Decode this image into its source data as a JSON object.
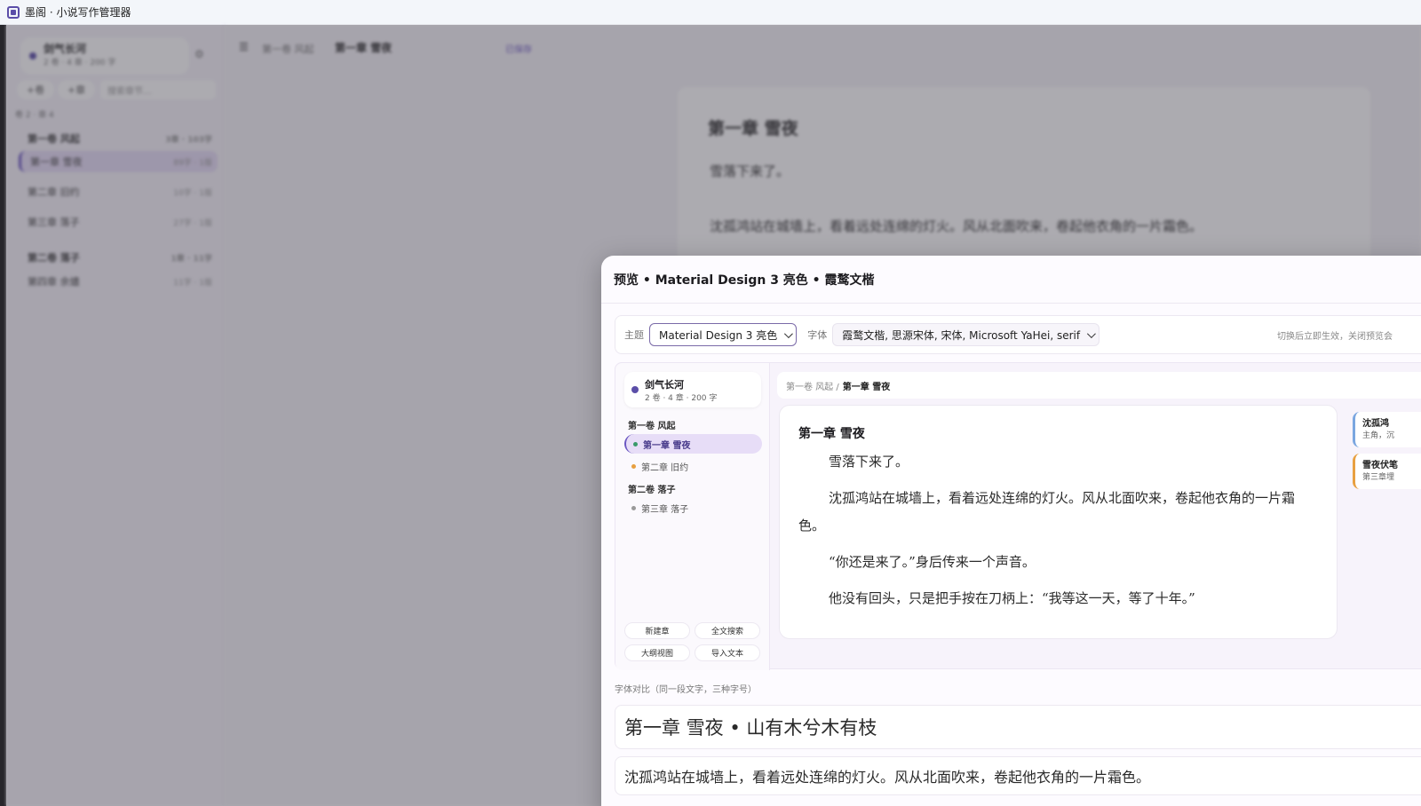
{
  "window": {
    "title": "墨阁 · 小说写作管理器"
  },
  "background": {
    "book": {
      "name": "剑气长河",
      "meta": "2 卷 · 4 章 · 200 字"
    },
    "toolbar": {
      "add_volume": "+卷",
      "add_chapter": "+章",
      "search_placeholder": "搜索章节..."
    },
    "stats": "卷 2 · 章 4",
    "tree": [
      {
        "label": "第一卷 风起",
        "meta": "3章 · 103字"
      },
      {
        "label": "第一章 雪夜",
        "meta": "89字 · 1版"
      },
      {
        "label": "第二章 旧约",
        "meta": "10字 · 1版"
      },
      {
        "label": "第三章 落子",
        "meta": "27字 · 1版"
      },
      {
        "label": "第二卷 落子",
        "meta": "1章 · 11字"
      },
      {
        "label": "第四章 余燼",
        "meta": "11字 · 1版"
      }
    ],
    "breadcrumb": {
      "volume": "第一卷 风起",
      "chapter": "第一章 雪夜"
    },
    "save_status": "已保存",
    "doc": {
      "title": "第一章 雪夜",
      "paragraphs": [
        "雪落下来了。",
        "沈孤鸿站在城墙上，看着远处连绵的灯火。风从北面吹来，卷起他衣角的一片霜色。"
      ]
    }
  },
  "dialog": {
    "title": "预览 • Material Design 3 亮色 • 霞鹜文楷",
    "controls": {
      "theme_label": "主题",
      "theme_value": "Material Design 3 亮色",
      "font_label": "字体",
      "font_value": "霞鹜文楷, 思源宋体, 宋体, Microsoft YaHei, serif",
      "hint": "切换后立即生效，关闭预览会"
    },
    "preview": {
      "book": {
        "name": "剑气长河",
        "meta": "2 卷 · 4 章 · 200 字"
      },
      "volumes": [
        {
          "label": "第一卷 风起",
          "chapters": [
            {
              "label": "第一章 雪夜",
              "dot": "#3a9a6a"
            },
            {
              "label": "第二章 旧约",
              "dot": "#e8a040"
            }
          ]
        },
        {
          "label": "第二卷 落子",
          "chapters": [
            {
              "label": "第三章 落子",
              "dot": "#9a9a9a"
            }
          ]
        }
      ],
      "buttons": {
        "new_chapter": "新建章",
        "fulltext_search": "全文搜索",
        "outline_view": "大纲视图",
        "import_text": "导入文本"
      },
      "breadcrumb": {
        "volume": "第一卷 风起 /",
        "chapter": "第一章 雪夜"
      },
      "doc": {
        "title": "第一章 雪夜",
        "paragraphs": [
          "雪落下来了。",
          "沈孤鸿站在城墙上，看着远处连绵的灯火。风从北面吹来，卷起他衣角的一片霜色。",
          "“你还是来了。”身后传来一个声音。",
          "他没有回头，只是把手按在刀柄上：“我等这一天，等了十年。”"
        ]
      },
      "notes": [
        {
          "title": "沈孤鸿",
          "desc": "主角，沉",
          "color": "#7aa6e0"
        },
        {
          "title": "雪夜伏笔",
          "desc": "第三章埋",
          "color": "#e8a040"
        }
      ]
    },
    "compare": {
      "label": "字体对比（同一段文字，三种字号）",
      "heading_sample": "第一章  雪夜  •  山有木兮木有枝",
      "body_sample": "沈孤鸿站在城墙上，看着远处连绵的灯火。风从北面吹来，卷起他衣角的一片霜色。"
    }
  }
}
